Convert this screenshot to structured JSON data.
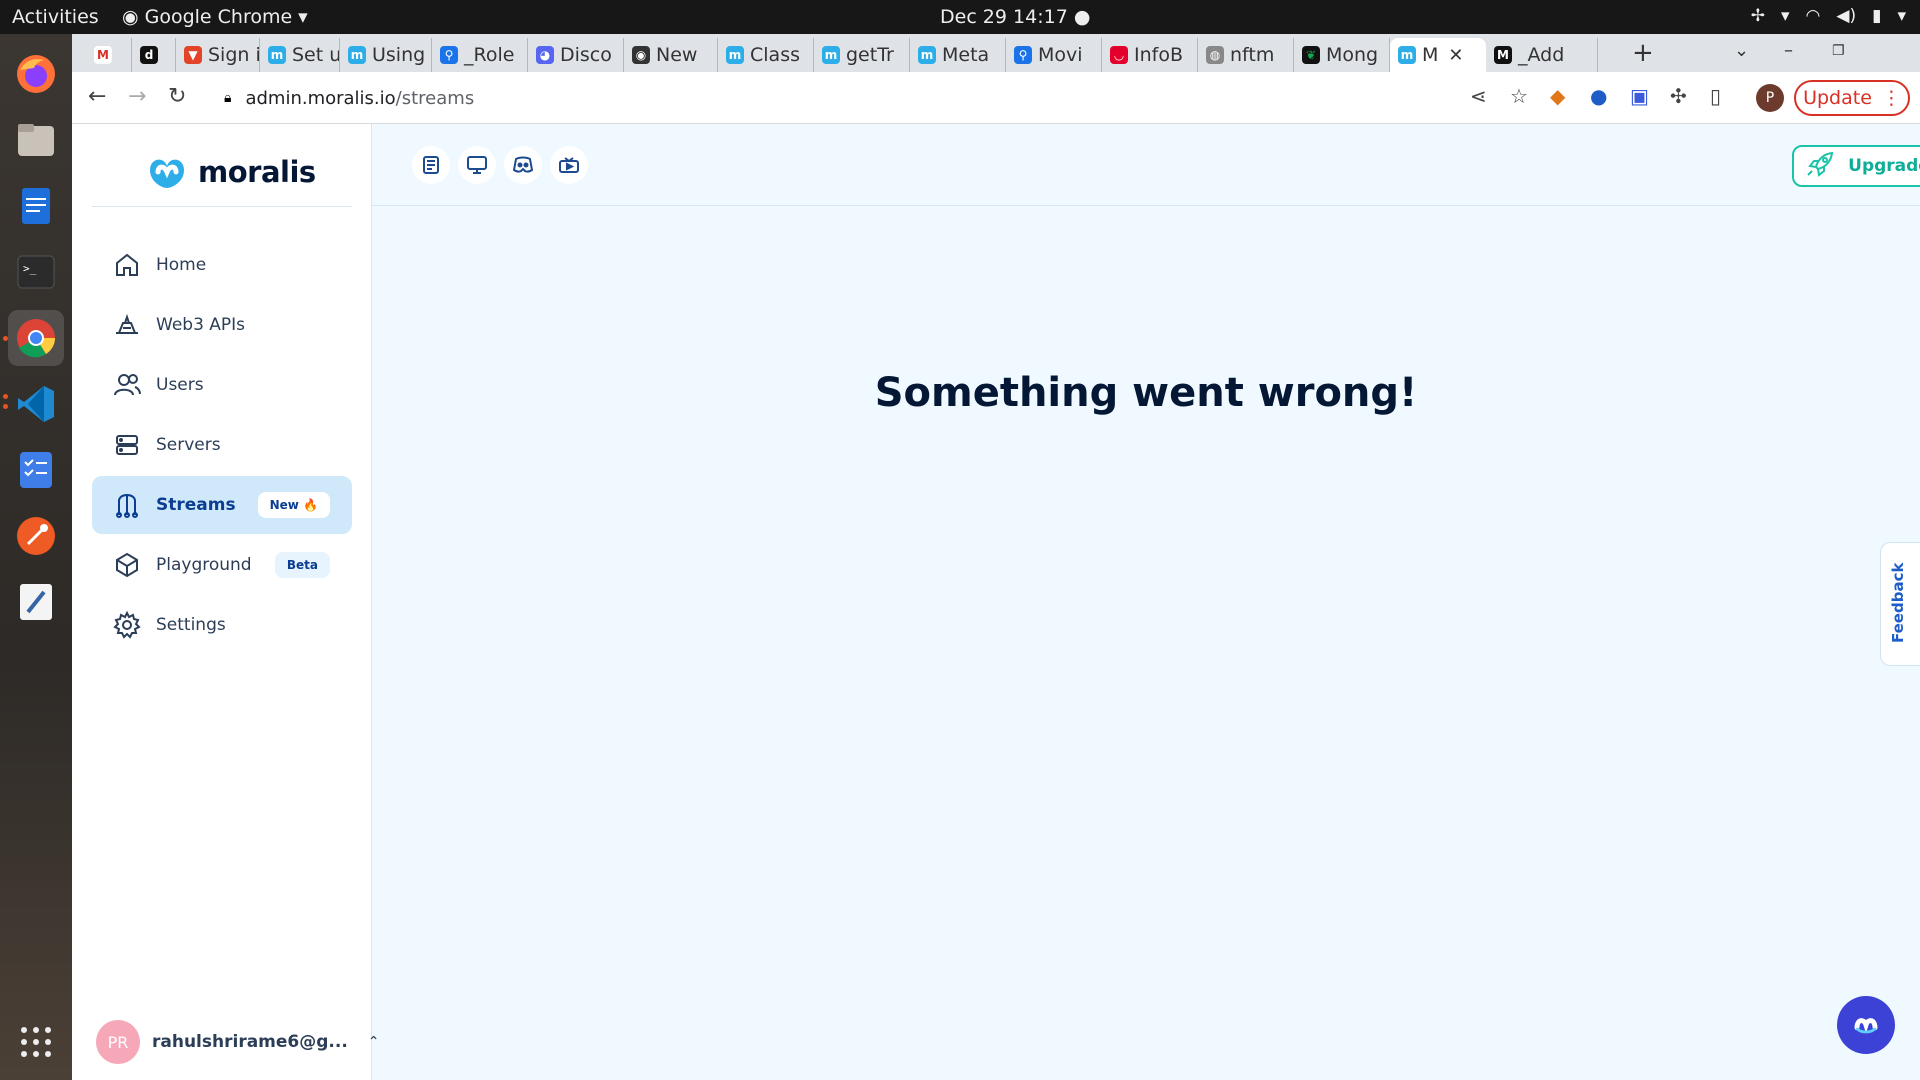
{
  "topbar": {
    "activities": "Activities",
    "app_name": "Google Chrome",
    "clock": "Dec 29  14:17"
  },
  "dock": {
    "items": [
      "firefox-icon",
      "files-icon",
      "writer-icon",
      "terminal-icon",
      "chrome-icon",
      "vscode-icon",
      "todo-icon",
      "postman-icon",
      "text-editor-icon",
      "app-grid-icon"
    ]
  },
  "browser": {
    "tabs": [
      {
        "title": "",
        "favicon": "gmail"
      },
      {
        "title": "",
        "favicon": "dev"
      },
      {
        "title": "Sign i",
        "favicon": "gitlab"
      },
      {
        "title": "Set u",
        "favicon": "moralis"
      },
      {
        "title": "Using",
        "favicon": "moralis"
      },
      {
        "title": "_Role",
        "favicon": "search"
      },
      {
        "title": "Disco",
        "favicon": "discord"
      },
      {
        "title": "New",
        "favicon": "github"
      },
      {
        "title": "Class",
        "favicon": "moralis"
      },
      {
        "title": "getTr",
        "favicon": "moralis"
      },
      {
        "title": "Meta",
        "favicon": "moralis"
      },
      {
        "title": "Movi",
        "favicon": "search"
      },
      {
        "title": "InfoB",
        "favicon": "infobip"
      },
      {
        "title": "nftm",
        "favicon": "globe"
      },
      {
        "title": "Mong",
        "favicon": "mongodb"
      },
      {
        "title": "M",
        "favicon": "moralis",
        "active": true
      },
      {
        "title": "_Add",
        "favicon": "dev"
      }
    ],
    "url_host": "admin.moralis.io",
    "url_path": "/streams",
    "update_label": "Update",
    "profile_initial": "P"
  },
  "app": {
    "logo_text": "moralis",
    "nav": [
      {
        "label": "Home",
        "icon": "home-icon"
      },
      {
        "label": "Web3 APIs",
        "icon": "api-icon"
      },
      {
        "label": "Users",
        "icon": "users-icon"
      },
      {
        "label": "Servers",
        "icon": "servers-icon"
      },
      {
        "label": "Streams",
        "icon": "streams-icon",
        "badge": "New 🔥",
        "active": true
      },
      {
        "label": "Playground",
        "icon": "playground-icon",
        "badge": "Beta"
      },
      {
        "label": "Settings",
        "icon": "settings-icon"
      }
    ],
    "user": {
      "initials": "PR",
      "email": "rahulshrirame6@g..."
    },
    "header_buttons": [
      "docs-icon",
      "tutorials-icon",
      "discord-icon",
      "youtube-icon"
    ],
    "upgrade_label": "Upgrade",
    "error_message": "Something went wrong!",
    "feedback_label": "Feedback"
  },
  "colors": {
    "accent": "#1bc4a8",
    "nav_active_bg": "#cfe9fb",
    "page_bg": "#f0f9ff",
    "update_red": "#d93025"
  }
}
